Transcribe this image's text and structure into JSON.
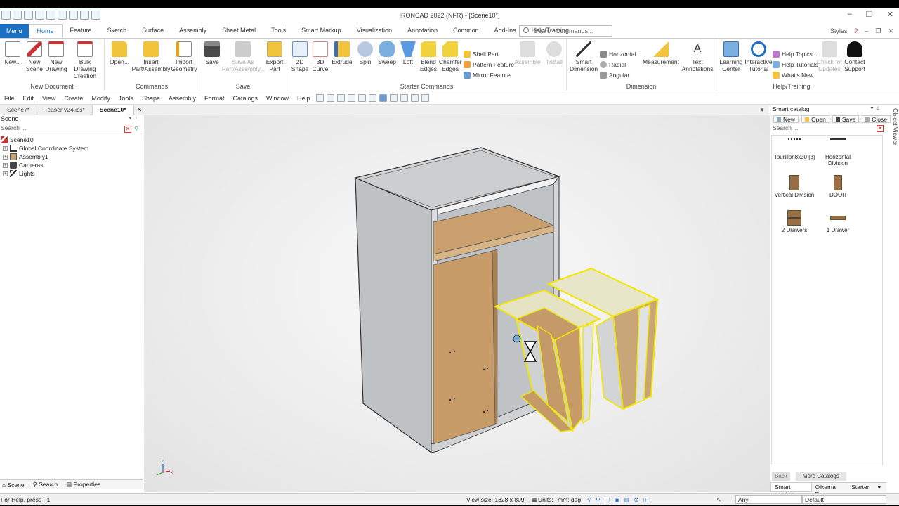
{
  "window": {
    "title": "IRONCAD 2022 (NFR) - [Scene10*]",
    "minimize": "–",
    "restore": "❐",
    "close": "✕"
  },
  "ribbon_tabs": [
    "Menu",
    "Home",
    "Feature",
    "Sketch",
    "Surface",
    "Assembly",
    "Sheet Metal",
    "Tools",
    "Smart Markup",
    "Visualization",
    "Annotation",
    "Common",
    "Add-Ins",
    "Help/Training"
  ],
  "active_tab": "Home",
  "command_search": {
    "placeholder": "Search Commands..."
  },
  "styles_label": "Styles",
  "ribbon": {
    "new_document": {
      "title": "New Document",
      "new": "New...",
      "new_scene": [
        "New",
        "Scene"
      ],
      "new_drawing": [
        "New",
        "Drawing"
      ],
      "bulk_drawing": [
        "Bulk Drawing",
        "Creation"
      ]
    },
    "commands": {
      "title": "Commands",
      "open": "Open...",
      "insert": [
        "Insert",
        "Part/Assembly"
      ],
      "import": [
        "Import",
        "Geometry"
      ]
    },
    "save": {
      "title": "Save",
      "save": "Save",
      "save_as": [
        "Save As",
        "Part/Assembly..."
      ],
      "export": [
        "Export",
        "Part"
      ]
    },
    "starter": {
      "title": "Starter Commands",
      "shape2d": [
        "2D",
        "Shape"
      ],
      "curve3d": [
        "3D",
        "Curve"
      ],
      "extrude": "Extrude",
      "spin": "Spin",
      "sweep": "Sweep",
      "loft": "Loft",
      "blend": [
        "Blend",
        "Edges"
      ],
      "chamfer": [
        "Chamfer",
        "Edges"
      ],
      "shell": "Shell Part",
      "pattern": "Pattern Feature",
      "mirror": "Mirror Feature",
      "assemble": "Assemble",
      "triball": "TriBall"
    },
    "dimension": {
      "title": "Dimension",
      "smart": [
        "Smart",
        "Dimension"
      ],
      "horizontal": "Horizontal",
      "radial": "Radial",
      "angular": "Angular",
      "measurement": "Measurement",
      "text": [
        "Text",
        "Annotations"
      ]
    },
    "help": {
      "title": "Help/Training",
      "learning": [
        "Learning",
        "Center"
      ],
      "interactive": [
        "Interactive",
        "Tutorial"
      ],
      "help_topics": "Help Topics...",
      "help_tutorials": "Help Tutorials",
      "whats_new": "What's New",
      "check_updates": [
        "Check for",
        "Updates"
      ],
      "contact": [
        "Contact",
        "Support"
      ]
    }
  },
  "menubar": [
    "File",
    "Edit",
    "View",
    "Create",
    "Modify",
    "Tools",
    "Shape",
    "Assembly",
    "Format",
    "Catalogs",
    "Window",
    "Help"
  ],
  "doc_tabs": [
    "Scene7*",
    "Teaser v24.ics*",
    "Scene10*"
  ],
  "active_doc": "Scene10*",
  "scene_panel": {
    "title": "Scene",
    "search_placeholder": "Search ...",
    "tree": [
      {
        "label": "Scene10",
        "level": 0
      },
      {
        "label": "Global Coordinate System",
        "level": 1
      },
      {
        "label": "Assembly1",
        "level": 1
      },
      {
        "label": "Cameras",
        "level": 1
      },
      {
        "label": "Lights",
        "level": 1
      }
    ],
    "footer_tabs": [
      "Scene",
      "Search",
      "Properties"
    ]
  },
  "catalog": {
    "title": "Smart catalog",
    "buttons": [
      "New",
      "Open",
      "Save",
      "Close"
    ],
    "search_placeholder": "Search ...",
    "items": [
      {
        "label": "Tourillon8x30 [3]"
      },
      {
        "label": "Horizontal Division"
      },
      {
        "label": "Vertical Division"
      },
      {
        "label": "DOOR"
      },
      {
        "label": "2 Drawers"
      },
      {
        "label": "1 Drawer"
      }
    ],
    "back": "Back",
    "more": "More Catalogs",
    "tabs": [
      "Smart catalog",
      "Oikema Eng",
      "Starter"
    ]
  },
  "object_viewer": "Object Viewer",
  "status": {
    "help": "For Help, press F1",
    "view_size": "View size: 1328 x 809",
    "units_label": "Units:",
    "units_value": "mm; deg",
    "filter": "Any",
    "style": "Default"
  },
  "colors": {
    "accent": "#1d6fc4",
    "cabinet_gray": "#c9cbcd",
    "wood": "#c8a070",
    "selection_yellow": "#f2e600"
  }
}
